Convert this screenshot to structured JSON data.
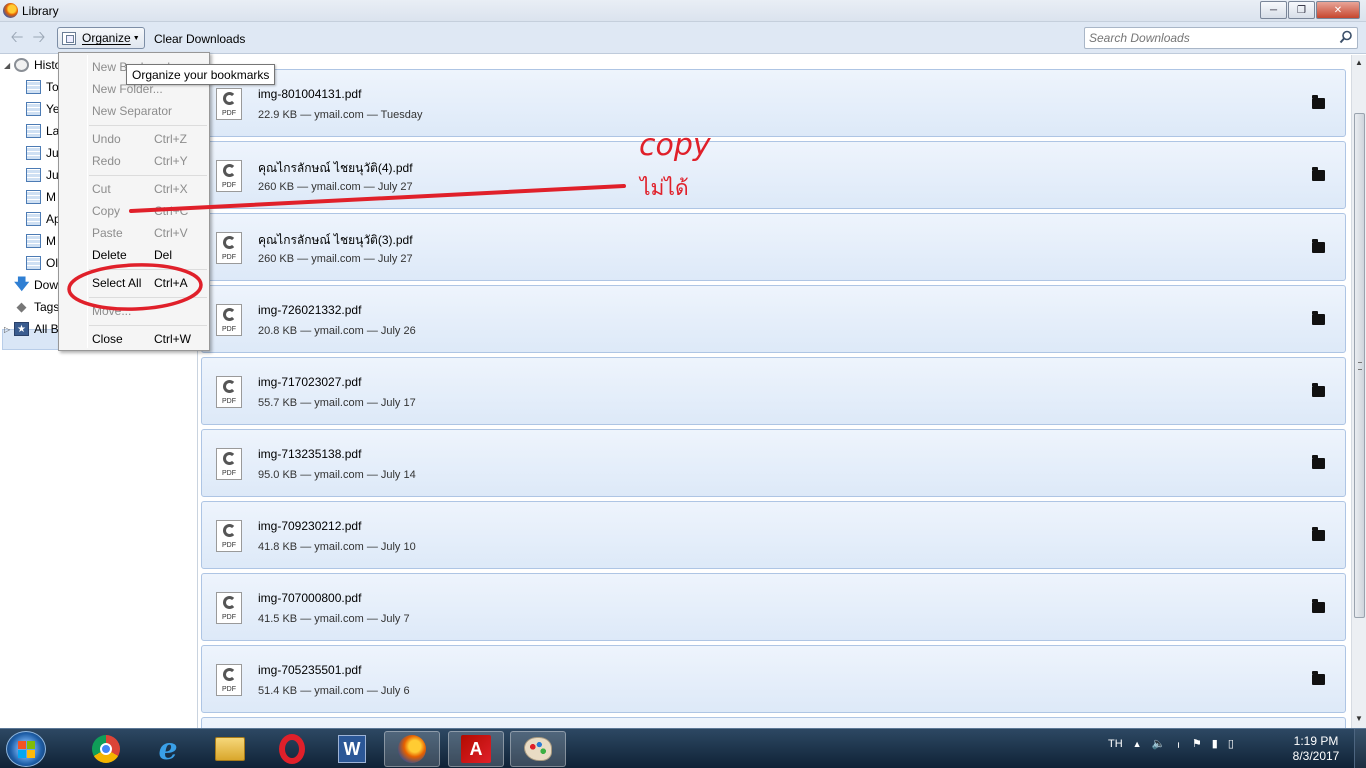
{
  "window": {
    "title": "Library"
  },
  "toolbar": {
    "organize_label": "Organize",
    "clear_label": "Clear Downloads",
    "search_placeholder": "Search Downloads"
  },
  "sidebar": {
    "items": [
      {
        "label": "Histo",
        "icon": "clock-icon"
      },
      {
        "label": "To",
        "icon": "calendar-icon"
      },
      {
        "label": "Ye",
        "icon": "calendar-icon"
      },
      {
        "label": "La",
        "icon": "calendar-icon"
      },
      {
        "label": "Ju",
        "icon": "calendar-icon"
      },
      {
        "label": "Ju",
        "icon": "calendar-icon"
      },
      {
        "label": "M",
        "icon": "calendar-icon"
      },
      {
        "label": "Ap",
        "icon": "calendar-icon"
      },
      {
        "label": "M",
        "icon": "calendar-icon"
      },
      {
        "label": "Ol",
        "icon": "calendar-icon"
      },
      {
        "label": "Dow",
        "icon": "download-icon"
      },
      {
        "label": "Tags",
        "icon": "tag-icon"
      },
      {
        "label": "All B",
        "icon": "star-icon"
      }
    ]
  },
  "menu": {
    "items": [
      {
        "label": "New Bookmark...",
        "shortcut": "",
        "enabled": false
      },
      {
        "label": "New Folder...",
        "shortcut": "",
        "enabled": false
      },
      {
        "label": "New Separator",
        "shortcut": "",
        "enabled": false
      },
      {
        "label": "Undo",
        "shortcut": "Ctrl+Z",
        "enabled": false
      },
      {
        "label": "Redo",
        "shortcut": "Ctrl+Y",
        "enabled": false
      },
      {
        "label": "Cut",
        "shortcut": "Ctrl+X",
        "enabled": false
      },
      {
        "label": "Copy",
        "shortcut": "Ctrl+C",
        "enabled": false
      },
      {
        "label": "Paste",
        "shortcut": "Ctrl+V",
        "enabled": false
      },
      {
        "label": "Delete",
        "shortcut": "Del",
        "enabled": true
      },
      {
        "label": "Select All",
        "shortcut": "Ctrl+A",
        "enabled": true
      },
      {
        "label": "Move...",
        "shortcut": "",
        "enabled": false
      },
      {
        "label": "Close",
        "shortcut": "Ctrl+W",
        "enabled": true
      }
    ]
  },
  "tooltip": "Organize your bookmarks",
  "downloads": [
    {
      "name": "img-801004131.pdf",
      "meta": "22.9 KB — ymail.com — Tuesday"
    },
    {
      "name": "คุณไกรลักษณ์ ไชยนุวัติ(4).pdf",
      "meta": "260 KB — ymail.com — July 27"
    },
    {
      "name": "คุณไกรลักษณ์ ไชยนุวัติ(3).pdf",
      "meta": "260 KB — ymail.com — July 27"
    },
    {
      "name": "img-726021332.pdf",
      "meta": "20.8 KB — ymail.com — July 26"
    },
    {
      "name": "img-717023027.pdf",
      "meta": "55.7 KB — ymail.com — July 17"
    },
    {
      "name": "img-713235138.pdf",
      "meta": "95.0 KB — ymail.com — July 14"
    },
    {
      "name": "img-709230212.pdf",
      "meta": "41.8 KB — ymail.com — July 10"
    },
    {
      "name": "img-707000800.pdf",
      "meta": "41.5 KB — ymail.com — July 7"
    },
    {
      "name": "img-705235501.pdf",
      "meta": "51.4 KB — ymail.com — July 6"
    }
  ],
  "annotation": {
    "copy_text": "copy",
    "thai_text": "ไม่ได้",
    "color": "#e0202a"
  },
  "taskbar": {
    "apps": [
      "chrome-icon",
      "internet-explorer-icon",
      "file-explorer-icon",
      "opera-icon",
      "word-icon",
      "firefox-icon",
      "acrobat-icon",
      "paint-icon"
    ],
    "language": "TH",
    "time": "1:19 PM",
    "date": "8/3/2017"
  }
}
